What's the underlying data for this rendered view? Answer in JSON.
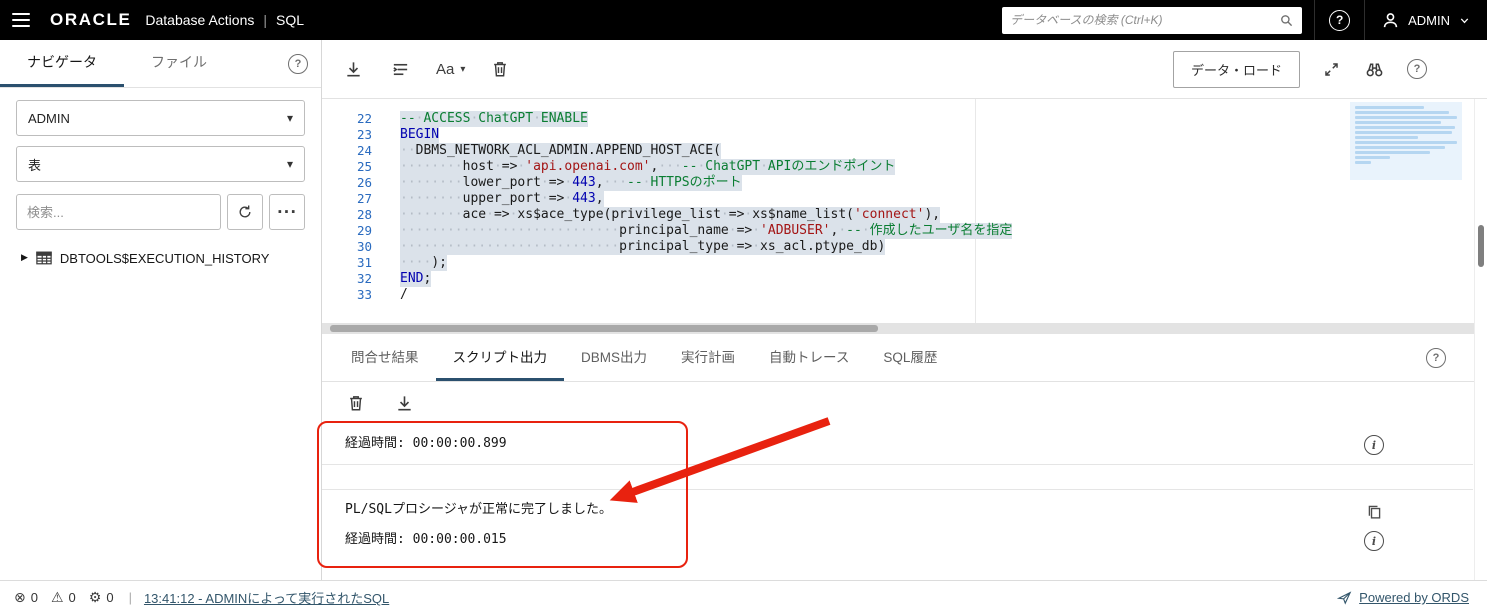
{
  "topbar": {
    "logo": "ORACLE",
    "product": "Database Actions",
    "separator": "|",
    "context": "SQL",
    "search_placeholder": "データベースの検索 (Ctrl+K)",
    "user_name": "ADMIN"
  },
  "icons": {
    "help_glyph": "?",
    "info_glyph": "i",
    "select_chevron": "▾",
    "tree_caret": "▶",
    "more_glyph": "···",
    "error_glyph": "⊗",
    "warning_glyph": "⚠",
    "gear_glyph": "⚙"
  },
  "sidebar": {
    "tabs": [
      {
        "label": "ナビゲータ",
        "active": true
      },
      {
        "label": "ファイル",
        "active": false
      }
    ],
    "schema_value": "ADMIN",
    "object_type_value": "表",
    "search_placeholder": "検索...",
    "tree_items": [
      {
        "label": "DBTOOLS$EXECUTION_HISTORY"
      }
    ]
  },
  "editor": {
    "toolbar": {
      "font_label": "Aa",
      "data_load_label": "データ・ロード"
    },
    "lines": [
      {
        "num": 22,
        "hl": true,
        "segs": [
          {
            "c": "c",
            "t": "--·ACCESS·ChatGPT·ENABLE"
          }
        ]
      },
      {
        "num": 23,
        "hl": true,
        "segs": [
          {
            "c": "k",
            "t": "BEGIN"
          }
        ]
      },
      {
        "num": 24,
        "hl": true,
        "segs": [
          {
            "c": "p",
            "t": "··DBMS_NETWORK_ACL_ADMIN.APPEND_HOST_ACE("
          }
        ]
      },
      {
        "num": 25,
        "hl": true,
        "segs": [
          {
            "c": "p",
            "t": "········host·=>·"
          },
          {
            "c": "s",
            "t": "'api.openai.com'"
          },
          {
            "c": "p",
            "t": ",···"
          },
          {
            "c": "c",
            "t": "--·ChatGPT·APIのエンドポイント"
          }
        ]
      },
      {
        "num": 26,
        "hl": true,
        "segs": [
          {
            "c": "p",
            "t": "········lower_port·=>·"
          },
          {
            "c": "n",
            "t": "443"
          },
          {
            "c": "p",
            "t": ",···"
          },
          {
            "c": "c",
            "t": "--·HTTPSのポート"
          }
        ]
      },
      {
        "num": 27,
        "hl": true,
        "segs": [
          {
            "c": "p",
            "t": "········upper_port·=>·"
          },
          {
            "c": "n",
            "t": "443"
          },
          {
            "c": "p",
            "t": ","
          }
        ]
      },
      {
        "num": 28,
        "hl": true,
        "segs": [
          {
            "c": "p",
            "t": "········ace·=>·xs$ace_type(privilege_list·=>·xs$name_list("
          },
          {
            "c": "s",
            "t": "'connect'"
          },
          {
            "c": "p",
            "t": "),"
          }
        ]
      },
      {
        "num": 29,
        "hl": true,
        "segs": [
          {
            "c": "p",
            "t": "····························principal_name·=>·"
          },
          {
            "c": "s",
            "t": "'ADBUSER'"
          },
          {
            "c": "p",
            "t": ",·"
          },
          {
            "c": "c",
            "t": "--·作成したユーザ名を指定"
          }
        ]
      },
      {
        "num": 30,
        "hl": true,
        "segs": [
          {
            "c": "p",
            "t": "····························principal_type·=>·xs_acl.ptype_db)"
          }
        ]
      },
      {
        "num": 31,
        "hl": true,
        "segs": [
          {
            "c": "p",
            "t": "····);"
          }
        ]
      },
      {
        "num": 32,
        "hl": true,
        "segs": [
          {
            "c": "k",
            "t": "END"
          },
          {
            "c": "p",
            "t": ";"
          }
        ]
      },
      {
        "num": 33,
        "hl": false,
        "segs": [
          {
            "c": "p",
            "t": "/"
          }
        ]
      }
    ]
  },
  "output": {
    "tabs": [
      "問合せ結果",
      "スクリプト出力",
      "DBMS出力",
      "実行計画",
      "自動トレース",
      "SQL履歴"
    ],
    "active_tab": "スクリプト出力",
    "sections": [
      {
        "rows": [
          {
            "text": "経過時間: 00:00:00.899",
            "action": "info"
          }
        ]
      },
      {
        "rows": []
      },
      {
        "rows": [
          {
            "text": "PL/SQLプロシージャが正常に完了しました。",
            "action": "copy"
          },
          {
            "text": "経過時間: 00:00:00.015",
            "action": "info"
          }
        ]
      }
    ]
  },
  "statusbar": {
    "counters": [
      {
        "name": "errors",
        "count": "0"
      },
      {
        "name": "warnings",
        "count": "0"
      },
      {
        "name": "tasks",
        "count": "0"
      }
    ],
    "separator": "|",
    "last_run_link": "13:41:12 - ADMINによって実行されたSQL",
    "powered_by": "Powered by ORDS"
  }
}
